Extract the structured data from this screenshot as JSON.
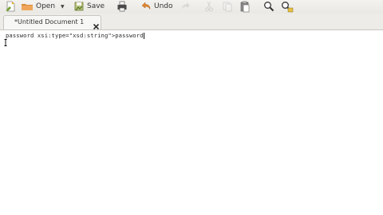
{
  "toolbar": {
    "new_icon": "new-document-icon",
    "open_label": "Open",
    "open_icon": "folder-icon",
    "open_dropdown_icon": "dropdown-arrow-icon",
    "save_label": "Save",
    "save_icon": "save-icon",
    "print_icon": "print-icon",
    "undo_label": "Undo",
    "undo_icon": "undo-icon",
    "redo_icon": "redo-icon",
    "cut_icon": "cut-icon",
    "copy_icon": "copy-icon",
    "paste_icon": "paste-icon",
    "find_icon": "find-icon",
    "replace_icon": "find-replace-icon"
  },
  "tabs": [
    {
      "label": "*Untitled Document 1",
      "close_icon": "close-icon"
    }
  ],
  "editor": {
    "lines": [
      "password xsi:type=\"xsd:string\">password"
    ]
  }
}
